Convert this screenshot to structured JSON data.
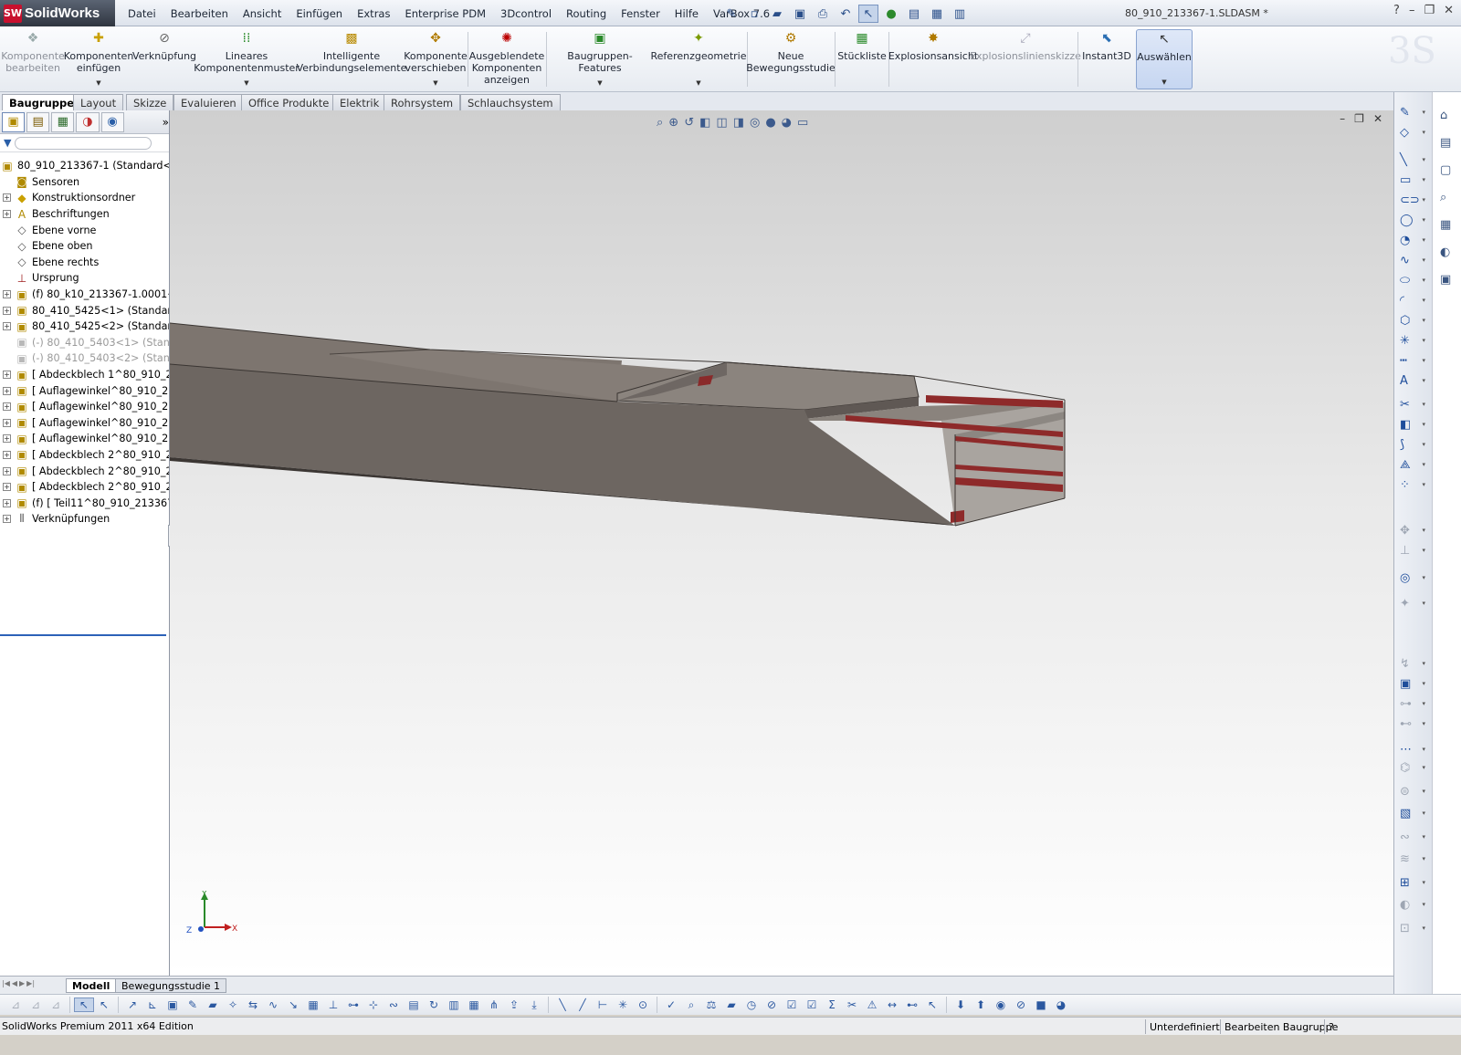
{
  "app": {
    "logo_mark": "SW",
    "logo_text": "SolidWorks",
    "document_title": "80_910_213367-1.SLDASM *",
    "accent_color": "#c8102e"
  },
  "menu": [
    "Datei",
    "Bearbeiten",
    "Ansicht",
    "Einfügen",
    "Extras",
    "Enterprise PDM",
    "3Dcontrol",
    "Routing",
    "Fenster",
    "Hilfe",
    "VarBox 7.6"
  ],
  "command_manager": {
    "komponente_bearbeiten": "Komponente bearbeiten",
    "komponenten_einfuegen": "Komponenten einfügen",
    "verknuepfung": "Verknüpfung",
    "lineares_komponentenmuster": "Lineares Komponentenmuster",
    "intelligente_verbindungselemente": "Intelligente Verbindungselemente",
    "komponente_verschieben": "Komponente verschieben",
    "ausgeblendete_komponenten": "Ausgeblendete Komponenten anzeigen",
    "baugruppen_features": "Baugruppen-Features",
    "referenzgeometrie": "Referenzgeometrie",
    "neue_bewegungsstudie": "Neue Bewegungsstudie",
    "stueckliste": "Stückliste",
    "explosionsansicht": "Explosionsansicht",
    "explosionslinienskizze": "Explosionslinienskizze",
    "instant3d": "Instant3D",
    "auswaehlen": "Auswählen"
  },
  "tabs": [
    "Baugruppe",
    "Layout",
    "Skizze",
    "Evaluieren",
    "Office Produkte",
    "Elektrik",
    "Rohrsystem",
    "Schlauchsystem"
  ],
  "tree": {
    "root": "80_910_213367-1  (Standard<Anz",
    "items": [
      {
        "label": "Sensoren",
        "icon": "sensor-icon",
        "expandable": false,
        "grey": false
      },
      {
        "label": "Konstruktionsordner",
        "icon": "design-binder-icon",
        "expandable": true,
        "grey": false
      },
      {
        "label": "Beschriftungen",
        "icon": "annotations-icon",
        "expandable": true,
        "grey": false
      },
      {
        "label": "Ebene vorne",
        "icon": "plane-icon",
        "expandable": false,
        "grey": false
      },
      {
        "label": "Ebene oben",
        "icon": "plane-icon",
        "expandable": false,
        "grey": false
      },
      {
        "label": "Ebene rechts",
        "icon": "plane-icon",
        "expandable": false,
        "grey": false
      },
      {
        "label": "Ursprung",
        "icon": "origin-icon",
        "expandable": false,
        "grey": false
      },
      {
        "label": "(f) 80_k10_213367-1.0001<1:",
        "icon": "part-icon",
        "expandable": true,
        "grey": false
      },
      {
        "label": "80_410_5425<1> (Standard<",
        "icon": "part-icon",
        "expandable": true,
        "grey": false
      },
      {
        "label": "80_410_5425<2> (Standard<",
        "icon": "part-icon",
        "expandable": true,
        "grey": false
      },
      {
        "label": "(-) 80_410_5403<1> (Standar",
        "icon": "part-icon",
        "expandable": false,
        "grey": true
      },
      {
        "label": "(-) 80_410_5403<2> (Standar",
        "icon": "part-icon",
        "expandable": false,
        "grey": true
      },
      {
        "label": "[ Abdeckblech 1^80_910_213:",
        "icon": "part-icon",
        "expandable": true,
        "grey": false
      },
      {
        "label": "[ Auflagewinkel^80_910_2133",
        "icon": "part-icon",
        "expandable": true,
        "grey": false
      },
      {
        "label": "[ Auflagewinkel^80_910_2133",
        "icon": "part-icon",
        "expandable": true,
        "grey": false
      },
      {
        "label": "[ Auflagewinkel^80_910_2133",
        "icon": "part-icon",
        "expandable": true,
        "grey": false
      },
      {
        "label": "[ Auflagewinkel^80_910_2133",
        "icon": "part-icon",
        "expandable": true,
        "grey": false
      },
      {
        "label": "[ Abdeckblech 2^80_910_213:",
        "icon": "part-icon",
        "expandable": true,
        "grey": false
      },
      {
        "label": "[ Abdeckblech 2^80_910_213:",
        "icon": "part-icon",
        "expandable": true,
        "grey": false
      },
      {
        "label": "[ Abdeckblech 2^80_910_213:",
        "icon": "part-icon",
        "expandable": true,
        "grey": false
      },
      {
        "label": "(f) [ Teil11^80_910_213367-1",
        "icon": "part-icon",
        "expandable": true,
        "grey": false
      },
      {
        "label": "Verknüpfungen",
        "icon": "mates-icon",
        "expandable": true,
        "grey": false
      }
    ]
  },
  "triad": {
    "x": "X",
    "y": "Y",
    "z": "Z"
  },
  "bottom_tabs": [
    "Modell",
    "Bewegungsstudie 1"
  ],
  "status": {
    "edition": "SolidWorks Premium 2011 x64 Edition",
    "definition": "Unterdefiniert",
    "mode": "Bearbeiten Baugruppe"
  }
}
